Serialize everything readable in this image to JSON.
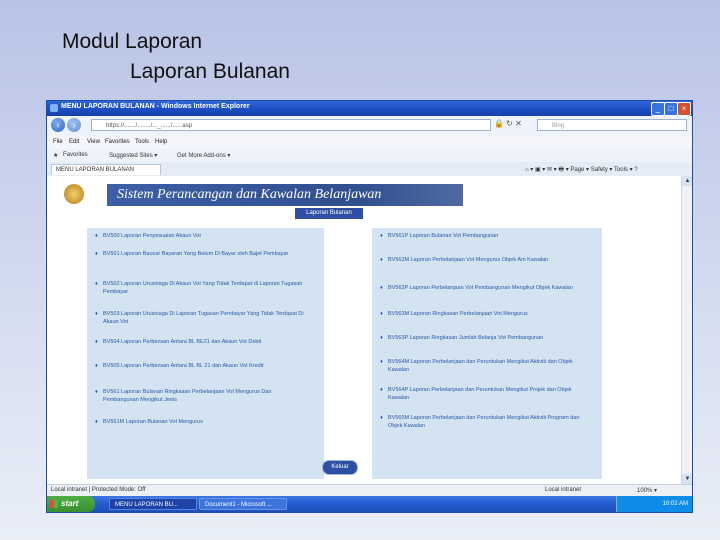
{
  "slide": {
    "title": "Modul Laporan",
    "subtitle": "Laporan Bulanan"
  },
  "window": {
    "title": "MENU LAPORAN BULANAN - Windows Internet Explorer",
    "address": "https://......./......../..._....../......asp",
    "search_placeholder": "Bing"
  },
  "menu": [
    "File",
    "Edit",
    "View",
    "Favorites",
    "Tools",
    "Help"
  ],
  "favorites": {
    "label": "Favorites",
    "items": [
      "Suggested Sites ▾",
      "Get More Add-ons ▾"
    ]
  },
  "tab": {
    "label": "MENU LAPORAN BULANAN"
  },
  "page": {
    "banner": "Sistem Perancangan dan Kawalan Belanjawan",
    "section_button": "Laporan Bulanan",
    "left_items": [
      "BV500 Laporan Penyesuaian Akaun Vot",
      "BV501 Laporan Baucar Bayaran Yang Belum Di Bayar oleh Bajet Pembayar",
      "BV502 Laporan Urusniaga Di Akaun Vot Yang Tidak Terdapat di Laporan Tugasan Pembayar",
      "BV503 Laporan Urusniaga Di Laporan Tugasan Pembayar Yang Tidak Terdapat Di Akaun Vot",
      "BV504 Laporan Perbezaan Antara BL BE21 dan Akaun Vot Debit",
      "BV505 Laporan Perbezaan Antara BL BL 21 dan Akaun Vot Kredit",
      "BV561 Laporan Bulanan Ringkasan Perbelanjaan Vot Mengurus Dan Pembangunan Mengikut Jenis",
      "BV561M Laporan Bulanan Vot Mengurus"
    ],
    "right_items": [
      "BV561P Laporan Bulanan Vot Pembangunan",
      "BV562M Laporan Perbelanjaan Vot Mengurus Objek Am Kawalan",
      "BV562P Laporan Perbelanjaan Vot Pembangunan Mengikut Objek Kawalan",
      "BV563M Laporan Ringkasan Perbelanjaan Vot Mengurus",
      "BV563P Laporan Ringkasan Jumlah Belanja Vot Pembangunan",
      "BV564M Laporan Perbelanjaan dan Peruntukan Mengikut Aktiviti dan Objek Kawalan",
      "BV564P Laporan Perbelanjaan dan Peruntukan Mengikut Projek dan Objek Kawalan",
      "BV565M Laporan Perbelanjaan dan Peruntukan Mengikut Aktiviti Program dan Objek Kawalan"
    ],
    "exit_button": "Keluar"
  },
  "status": {
    "left": "Local intranet | Protected Mode: Off",
    "zone": "Local intranet",
    "zoom": "100% ▾"
  },
  "taskbar": {
    "start": "start",
    "items": [
      "MENU LAPORAN BU...",
      "Document1 - Microsoft ..."
    ],
    "clock": "10:02 AM"
  }
}
